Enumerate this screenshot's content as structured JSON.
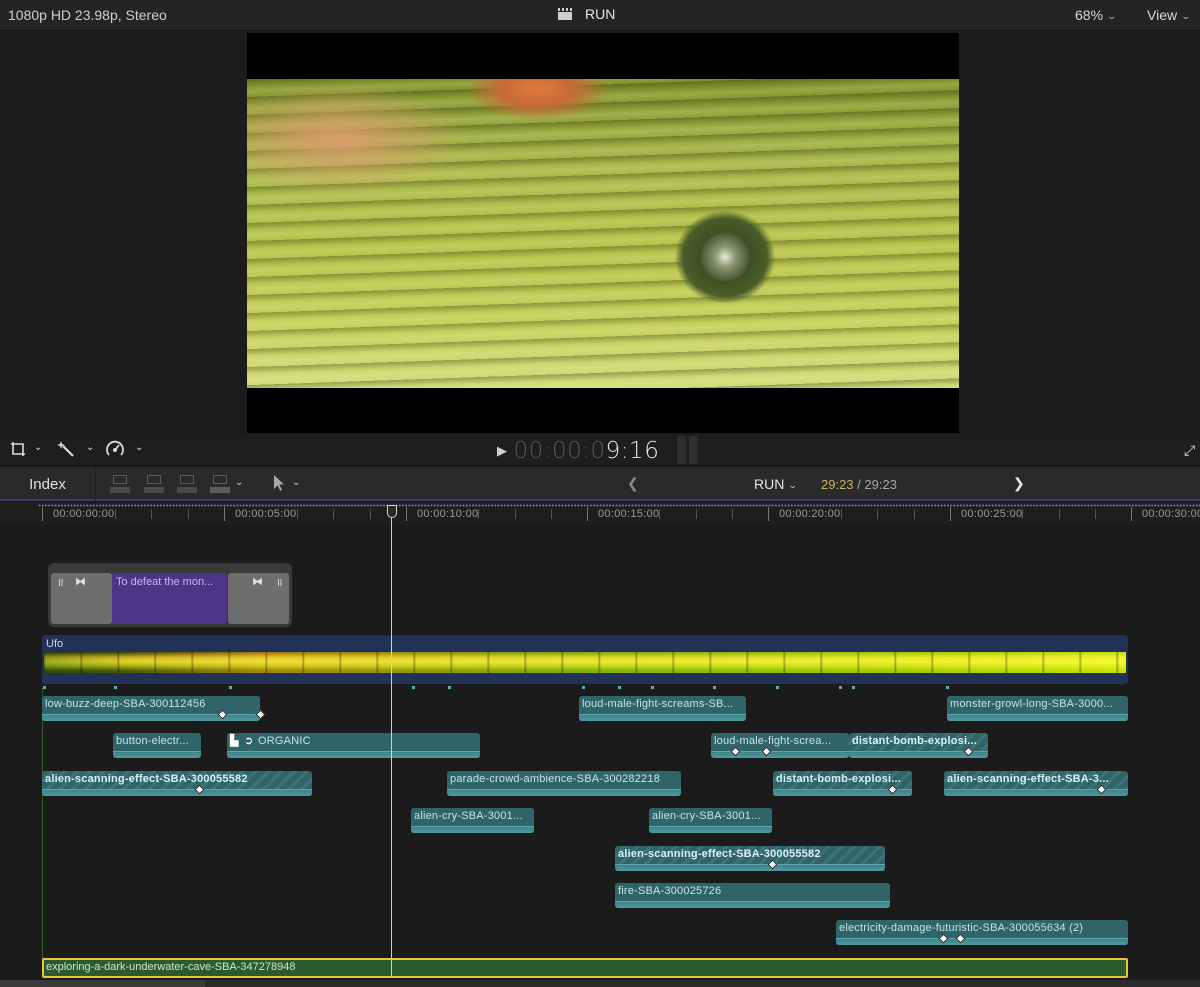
{
  "topbar": {
    "format": "1080p HD 23.98p, Stereo",
    "project_icon": "clapperboard-icon",
    "project_name": "RUN",
    "zoom": "68%",
    "view_label": "View"
  },
  "viewer_controls": {
    "transform_icon": "crop-transform-icon",
    "enhance_icon": "magic-wand-icon",
    "retime_icon": "speedometer-icon",
    "timecode_dim": "00:00:0",
    "timecode_bright": "9:16",
    "fullscreen_icon": "fullscreen-icon"
  },
  "timeline_header": {
    "index_label": "Index",
    "edit_tools": [
      "connect-clip-icon",
      "insert-clip-icon",
      "append-clip-icon",
      "overwrite-clip-icon"
    ],
    "select_tool": "arrow-pointer-icon",
    "project_name": "RUN",
    "current_duration": "29:23",
    "separator": " / ",
    "total_duration": "29:23"
  },
  "ruler": {
    "labels": [
      "00:00:00:00",
      "00:00:05:00",
      "00:00:10:00",
      "00:00:15:00",
      "00:00:20:00",
      "00:00:25:00",
      "00:00:30:00"
    ]
  },
  "connected_title": {
    "label": "To defeat the mon..."
  },
  "storyline": {
    "label": "Ufo"
  },
  "clips": [
    {
      "name": "low-buzz-deep-SBA-300112456",
      "bold": false,
      "striped": false
    },
    {
      "name": "loud-male-fight-screams-SB...",
      "bold": false,
      "striped": false
    },
    {
      "name": "monster-growl-long-SBA-3000...",
      "bold": false,
      "striped": false
    },
    {
      "name": "button-electr...",
      "bold": false,
      "striped": false
    },
    {
      "name": "ORGANIC",
      "bold": false,
      "striped": false
    },
    {
      "name": "loud-male-fight-screa...",
      "bold": false,
      "striped": false
    },
    {
      "name": "distant-bomb-explosi...",
      "bold": true,
      "striped": true
    },
    {
      "name": "alien-scanning-effect-SBA-300055582",
      "bold": true,
      "striped": true
    },
    {
      "name": "parade-crowd-ambience-SBA-300282218",
      "bold": false,
      "striped": false
    },
    {
      "name": "distant-bomb-explosi...",
      "bold": true,
      "striped": true
    },
    {
      "name": "alien-scanning-effect-SBA-3...",
      "bold": true,
      "striped": true
    },
    {
      "name": "alien-cry-SBA-3001...",
      "bold": false,
      "striped": false
    },
    {
      "name": "alien-cry-SBA-3001...",
      "bold": false,
      "striped": false
    },
    {
      "name": "alien-scanning-effect-SBA-300055582",
      "bold": true,
      "striped": true
    },
    {
      "name": "fire-SBA-300025726",
      "bold": false,
      "striped": false
    },
    {
      "name": "electricity-damage-futuristic-SBA-300055634 (2)",
      "bold": false,
      "striped": false
    }
  ],
  "music_clip": {
    "name": "exploring-a-dark-underwater-cave-SBA-347278948"
  },
  "colors": {
    "audio_clip": "#2f6469",
    "storyline": "#223256",
    "title_clip": "#4d3688",
    "music_clip": "#2a5a2e",
    "selection": "#e0c83a",
    "duration_current": "#c8b35a"
  }
}
